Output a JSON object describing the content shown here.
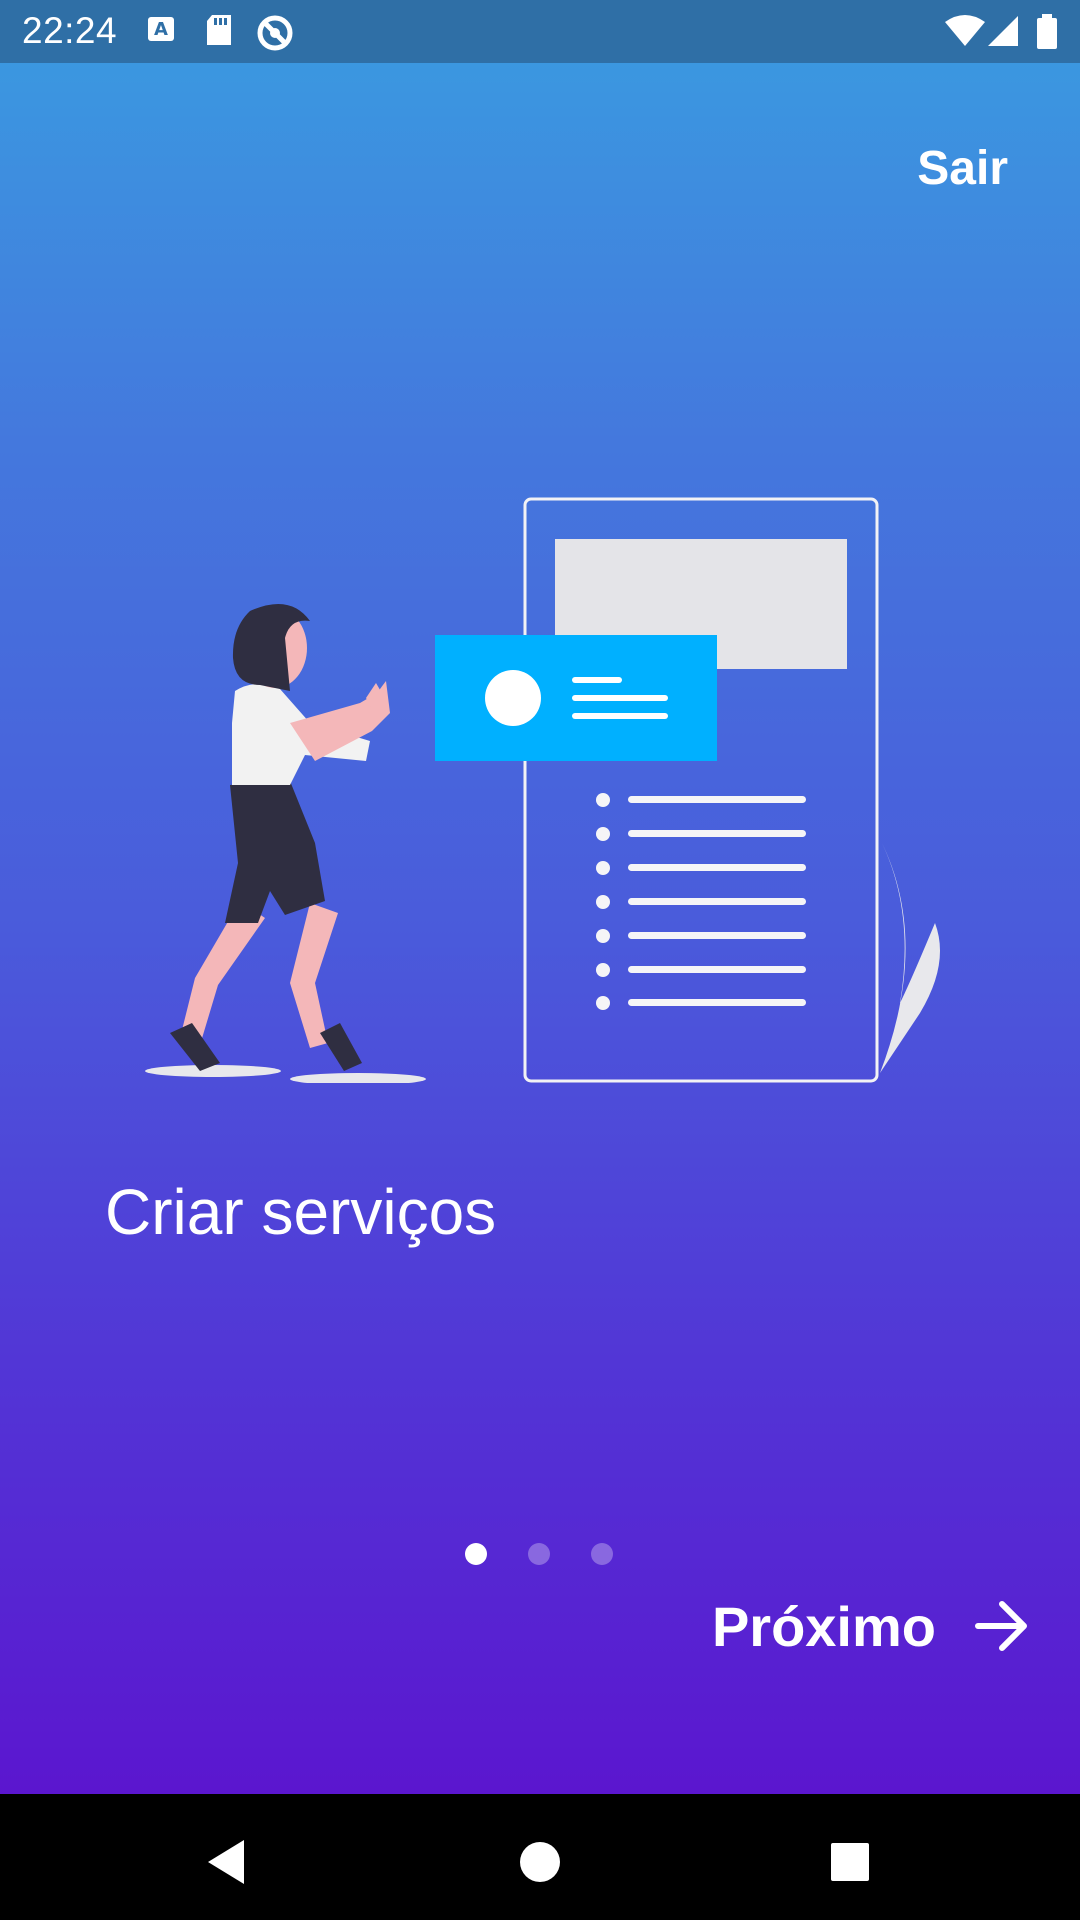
{
  "status_bar": {
    "time": "22:24",
    "icons": [
      "keyboard-icon",
      "sd-card-icon",
      "vpn-icon",
      "wifi-icon",
      "signal-icon",
      "battery-icon"
    ]
  },
  "onboarding": {
    "skip_label": "Sair",
    "title": "Criar serviços",
    "next_label": "Próximo",
    "page_indicator": {
      "current": 1,
      "total": 3
    },
    "colors": {
      "gradient_top": "#3b97e0",
      "gradient_bottom": "#5b16cf",
      "card_accent": "#00b0ff",
      "text": "#ffffff"
    }
  },
  "nav_bar": {
    "buttons": [
      "back-icon",
      "home-icon",
      "recents-icon"
    ]
  }
}
